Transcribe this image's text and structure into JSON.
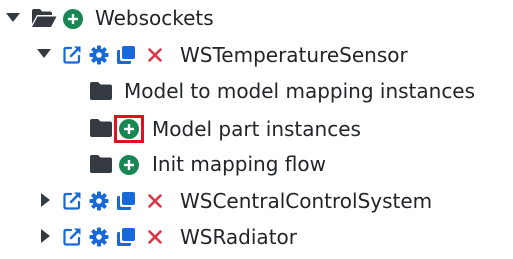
{
  "tree": {
    "root": {
      "label": "Websockets",
      "icons": [
        "caret-down-icon",
        "folder-open-icon",
        "add-icon"
      ]
    },
    "children": [
      {
        "label": "WSTemperatureSensor",
        "expanded": true,
        "icons": [
          "caret-down-icon",
          "external-link-icon",
          "gear-icon",
          "copy-icon",
          "delete-icon"
        ],
        "children": [
          {
            "label": "Model to model mapping instances",
            "icons": [
              "folder-icon"
            ]
          },
          {
            "label": "Model part instances",
            "icons": [
              "folder-icon",
              "add-icon"
            ],
            "highlighted": true
          },
          {
            "label": "Init mapping flow",
            "icons": [
              "folder-icon",
              "add-icon"
            ]
          }
        ]
      },
      {
        "label": "WSCentralControlSystem",
        "expanded": false,
        "icons": [
          "caret-right-icon",
          "external-link-icon",
          "gear-icon",
          "copy-icon",
          "delete-icon"
        ]
      },
      {
        "label": "WSRadiator",
        "expanded": false,
        "icons": [
          "caret-right-icon",
          "external-link-icon",
          "gear-icon",
          "copy-icon",
          "delete-icon"
        ]
      }
    ]
  },
  "colors": {
    "text": "#212529",
    "icon_dark": "#343a40",
    "link_blue": "#1669d8",
    "add_green": "#198754",
    "delete_red": "#dc3545",
    "highlight_red": "#e3101f"
  }
}
